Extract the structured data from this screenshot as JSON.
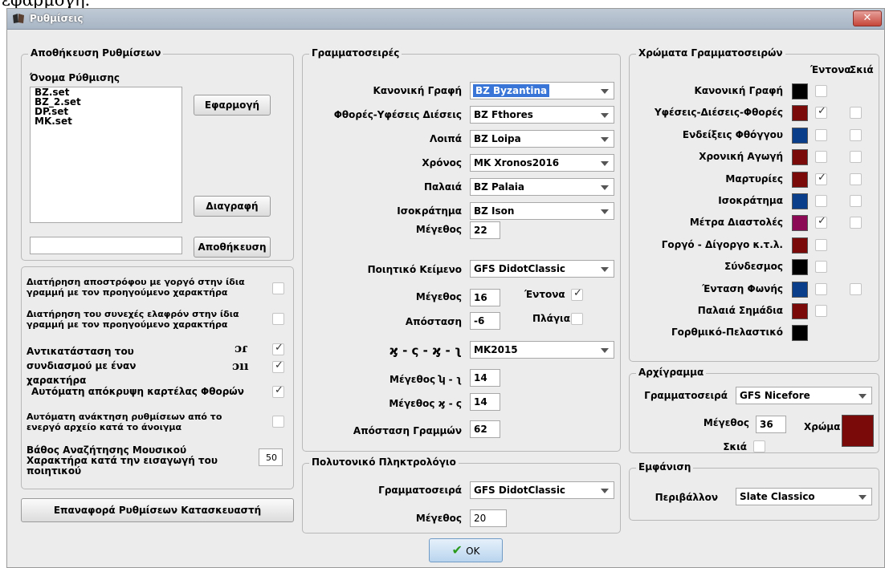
{
  "page_overflow_text": "εφαρμογή.",
  "window": {
    "title": "Ρυθμίσεις",
    "close_glyph": "✕"
  },
  "save_settings": {
    "group_title": "Αποθήκευση Ρυθμίσεων",
    "name_label": "Όνομα Ρύθμισης",
    "files": [
      "BZ.set",
      "BZ_2.set",
      "DP.set",
      "MK.set"
    ],
    "apply_label": "Εφαρμογή",
    "delete_label": "Διαγραφή",
    "save_input_value": "",
    "save_label": "Αποθήκευση"
  },
  "options": {
    "keep_apostrophe": "Διατήρηση αποστρόφου με γοργό στην ίδια γραμμή με τον προηγούμενο χαρακτήρα",
    "keep_continuous": "Διατήρηση του συνεχές ελαφρόν στην ίδια γραμμή με τον προηγούμενο χαρακτήρα",
    "replace_combo": "Αντικατάσταση του συνδιασμού με έναν χαρακτήρα",
    "replace_glyph_1": "ɔɾ",
    "replace_glyph_2": "ɔıı",
    "auto_hide": "Αυτόματη απόκρυψη καρτέλας Φθορών",
    "auto_restore": "Αυτόματη ανάκτηση ρυθμίσεων από το ενεργό αρχείο κατά το άνοιγμα",
    "search_depth": "Βάθος Αναζήτησης Μουσικού Χαρακτήρα κατά την εισαγωγή του ποιητικού",
    "search_depth_value": "50",
    "checks": {
      "keep_apostrophe": false,
      "keep_continuous": false,
      "replace_1": true,
      "replace_2": true,
      "auto_hide": true,
      "auto_restore": false
    }
  },
  "reset_label": "Επαναφορά Ρυθμίσεων  Κατασκευαστή",
  "fonts": {
    "group_title": "Γραμματοσειρές",
    "rows": [
      {
        "label": "Κανονική Γραφή",
        "value": "BZ Byzantina"
      },
      {
        "label": "Φθορές-Υφέσεις Διέσεις",
        "value": "BZ Fthores"
      },
      {
        "label": "Λοιπά",
        "value": "BZ Loipa"
      },
      {
        "label": "Χρόνος",
        "value": "MK Xronos2016"
      },
      {
        "label": "Παλαιά",
        "value": "BZ Palaia"
      },
      {
        "label": "Ισοκράτημα",
        "value": "BZ Ison"
      }
    ],
    "size_label": "Μέγεθος",
    "size_value": "22",
    "poetic_label": "Ποιητικό Κείμενο",
    "poetic_value": "GFS DidotClassic",
    "poetic_size_label": "Μέγεθος",
    "poetic_size_value": "16",
    "bold_label": "Έντονα",
    "bold_checked": true,
    "distance_label": "Απόσταση",
    "distance_value": "-6",
    "italic_label": "Πλάγια",
    "italic_checked": false,
    "marks_label": "ϗ - ς - ϗ - ʅ",
    "marks_value": "MK2015",
    "size_lu_label": "Μέγεθος  ʮ - ʅ",
    "size_lu_value": "14",
    "size_ks_label": "Μέγεθος  ϗ - ς",
    "size_ks_value": "14",
    "line_gap_label": "Απόσταση Γραμμών",
    "line_gap_value": "62"
  },
  "keyboard": {
    "group_title": "Πολυτονικό Πληκτρολόγιο",
    "font_label": "Γραμματοσειρά",
    "font_value": "GFS DidotClassic",
    "size_label": "Μέγεθος",
    "size_value": "20"
  },
  "ok_label": "OK",
  "colors": {
    "group_title": "Χρώματα Γραμματοσειρών",
    "bold_header": "Έντονα",
    "shadow_header": "Σκιά",
    "rows": [
      {
        "label": "Κανονική Γραφή",
        "color": "#000000",
        "bold": false,
        "has_shadow": false,
        "shadow": false
      },
      {
        "label": "Υφέσεις-Διέσεις-Φθορές",
        "color": "#7a0a0a",
        "bold": true,
        "has_shadow": true,
        "shadow": false
      },
      {
        "label": "Ενδείξεις Φθόγγου",
        "color": "#0a3d8a",
        "bold": false,
        "has_shadow": true,
        "shadow": false
      },
      {
        "label": "Χρονική Αγωγή",
        "color": "#7a0a0a",
        "bold": false,
        "has_shadow": true,
        "shadow": false
      },
      {
        "label": "Μαρτυρίες",
        "color": "#7a0a0a",
        "bold": true,
        "has_shadow": true,
        "shadow": false
      },
      {
        "label": "Ισοκράτημα",
        "color": "#0a3d8a",
        "bold": false,
        "has_shadow": true,
        "shadow": false
      },
      {
        "label": "Μέτρα Διαστολές",
        "color": "#8c0a55",
        "bold": true,
        "has_shadow": true,
        "shadow": false
      },
      {
        "label": "Γοργό - Δίγοργο κ.τ.λ.",
        "color": "#7a0a0a",
        "bold": false,
        "has_shadow": false,
        "shadow": false
      },
      {
        "label": "Σύνδεσμος",
        "color": "#000000",
        "bold": false,
        "has_shadow": false,
        "shadow": false
      },
      {
        "label": "Ένταση Φωνής",
        "color": "#0a3d8a",
        "bold": false,
        "has_shadow": true,
        "shadow": false
      },
      {
        "label": "Παλαιά Σημάδια",
        "color": "#7a0a0a",
        "bold": false,
        "has_shadow": false,
        "shadow": false
      },
      {
        "label": "Γορθμικό-Πελαστικό",
        "color": "#000000",
        "bold": null,
        "has_shadow": false,
        "shadow": false
      }
    ]
  },
  "initial": {
    "group_title": "Αρχίγραμμα",
    "font_label": "Γραμματοσειρά",
    "font_value": "GFS Nicefore",
    "size_label": "Μέγεθος",
    "size_value": "36",
    "color_label": "Χρώμα",
    "color": "#7a0a0a",
    "shadow_label": "Σκιά",
    "shadow_checked": false
  },
  "appearance": {
    "group_title": "Εμφάνιση",
    "env_label": "Περιβάλλον",
    "env_value": "Slate Classico"
  }
}
